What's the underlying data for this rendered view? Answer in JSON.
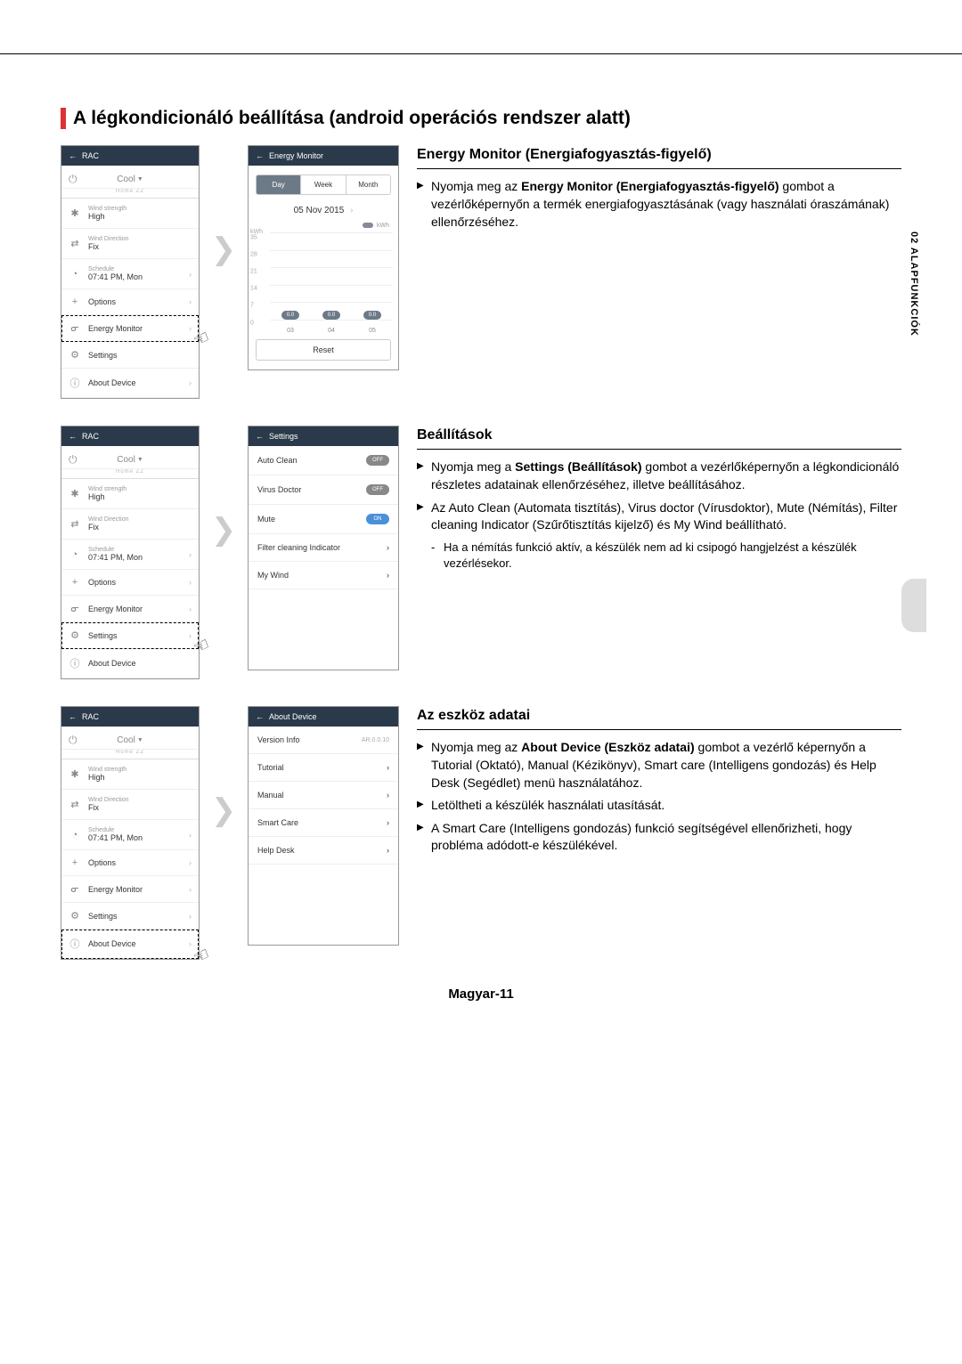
{
  "page_title": "A légkondicionáló beállítása (android operációs rendszer alatt)",
  "side_tab": "02 ALAPFUNKCIÓK",
  "footer": "Magyar-11",
  "rac_screen": {
    "header": "RAC",
    "mode": "Cool",
    "sub": "Home ZZ",
    "items": {
      "wind_strength_label": "Wind strength",
      "wind_strength_value": "High",
      "wind_direction_label": "Wind Direction",
      "wind_direction_value": "Fix",
      "schedule_label": "Schedule",
      "schedule_value": "07:41 PM, Mon",
      "options": "Options",
      "energy_monitor": "Energy Monitor",
      "settings": "Settings",
      "about_device": "About Device"
    }
  },
  "energy_monitor": {
    "header": "Energy Monitor",
    "tabs": {
      "day": "Day",
      "week": "Week",
      "month": "Month"
    },
    "date": "05 Nov 2015",
    "legend": "kWh",
    "y_unit": "kWh",
    "y_ticks": [
      "35",
      "28",
      "21",
      "14",
      "7",
      "0"
    ],
    "x_ticks": [
      "03",
      "04",
      "05"
    ],
    "bar_values": [
      "0.0",
      "0.0",
      "0.0"
    ],
    "reset": "Reset"
  },
  "settings_screen": {
    "header": "Settings",
    "auto_clean": "Auto Clean",
    "auto_clean_state": "OFF",
    "virus_doctor": "Virus Doctor",
    "virus_doctor_state": "OFF",
    "mute": "Mute",
    "mute_state": "ON",
    "filter": "Filter cleaning Indicator",
    "my_wind": "My Wind"
  },
  "about_screen": {
    "header": "About Device",
    "version_info": "Version Info",
    "version_value": "AR.0.0.10",
    "tutorial": "Tutorial",
    "manual": "Manual",
    "smart_care": "Smart Care",
    "help_desk": "Help Desk"
  },
  "text": {
    "em_heading": "Energy Monitor (Energiafogyasztás-figyelő)",
    "em_b1a": "Nyomja meg az ",
    "em_b1_bold": "Energy Monitor (Energiafogyasztás-figyelő)",
    "em_b1b": " gombot a vezérlőképernyőn a termék energiafogyasztásának (vagy használati óraszámának) ellenőrzéséhez.",
    "set_heading": "Beállítások",
    "set_b1a": "Nyomja meg a ",
    "set_b1_bold": "Settings (Beállítások)",
    "set_b1b": " gombot a vezérlőképernyőn a légkondicionáló részletes adatainak ellenőrzéséhez, illetve beállításához.",
    "set_b2": "Az Auto Clean (Automata tisztítás), Virus doctor (Vírusdoktor), Mute (Némítás), Filter cleaning Indicator (Szűrőtisztítás kijelző) és My Wind beállítható.",
    "set_sub": "Ha a némítás funkció aktív, a készülék nem ad ki csipogó hangjelzést a készülék vezérlésekor.",
    "ab_heading": "Az eszköz adatai",
    "ab_b1a": "Nyomja meg az ",
    "ab_b1_bold": "About Device (Eszköz adatai)",
    "ab_b1b": " gombot a vezérlő képernyőn a Tutorial (Oktató), Manual (Kézikönyv), Smart care (Intelligens gondozás) és Help Desk (Segédlet) menü használatához.",
    "ab_b2": "Letöltheti a készülék használati utasítását.",
    "ab_b3": "A Smart Care (Intelligens gondozás) funkció segítségével ellenőrizheti, hogy probléma adódott-e készülékével."
  },
  "chart_data": {
    "type": "bar",
    "title": "Energy Monitor — 05 Nov 2015",
    "categories": [
      "03",
      "04",
      "05"
    ],
    "values": [
      0.0,
      0.0,
      0.0
    ],
    "xlabel": "",
    "ylabel": "kWh",
    "ylim": [
      0,
      35
    ],
    "y_ticks": [
      0,
      7,
      14,
      21,
      28,
      35
    ]
  }
}
